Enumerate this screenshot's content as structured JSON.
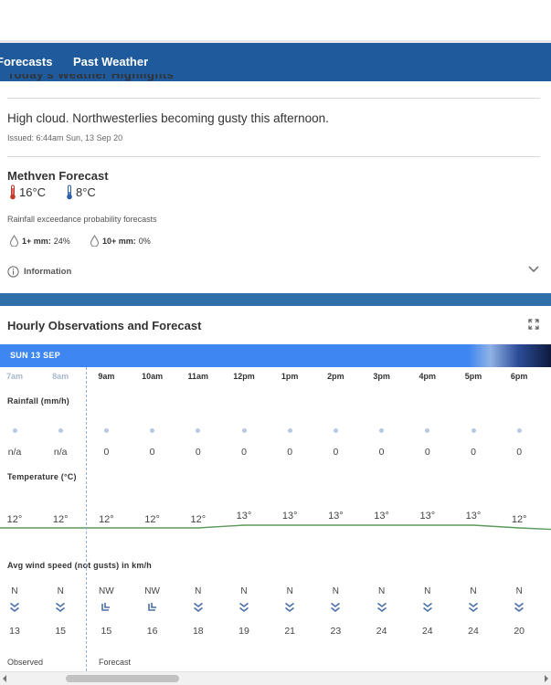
{
  "nav": {
    "items": [
      {
        "label": "Forecasts"
      },
      {
        "label": "Past Weather"
      }
    ]
  },
  "summary": {
    "cut_heading": "Today's Weather Highlights",
    "text": "High cloud. Northwesterlies becoming gusty this afternoon.",
    "issued": "Issued: 6:44am Sun, 13 Sep 20"
  },
  "forecast": {
    "title": "Methven Forecast",
    "high": "16°C",
    "low": "8°C",
    "rainfall_title": "Rainfall exceedance probability forecasts",
    "prob1_label": "1+ mm:",
    "prob1_value": "24%",
    "prob2_label": "10+ mm:",
    "prob2_value": "0%",
    "info_label": "Information"
  },
  "hourly": {
    "title": "Hourly Observations and Forecast",
    "day": "SUN 13 SEP",
    "rainfall_label": "Rainfall (mm/h)",
    "temperature_label": "Temperature (°C)",
    "wind_label": "Avg wind speed (not gusts) in km/h",
    "observed_label": "Observed",
    "forecast_label": "Forecast",
    "hours": [
      "7am",
      "8am",
      "9am",
      "10am",
      "11am",
      "12pm",
      "1pm",
      "2pm",
      "3pm",
      "4pm",
      "5pm",
      "6pm"
    ],
    "observed_count": 2,
    "rainfall": [
      "n/a",
      "n/a",
      "0",
      "0",
      "0",
      "0",
      "0",
      "0",
      "0",
      "0",
      "0",
      "0"
    ],
    "temperature": [
      "12°",
      "12°",
      "12°",
      "12°",
      "12°",
      "13°",
      "13°",
      "13°",
      "13°",
      "13°",
      "13°",
      "12°"
    ],
    "temperature_values": [
      12,
      12,
      12,
      12,
      12,
      13,
      13,
      13,
      13,
      13,
      13,
      12
    ],
    "wind_direction": [
      "N",
      "N",
      "NW",
      "NW",
      "N",
      "N",
      "N",
      "N",
      "N",
      "N",
      "N",
      "N"
    ],
    "wind_speed": [
      "13",
      "15",
      "15",
      "16",
      "18",
      "19",
      "21",
      "23",
      "24",
      "24",
      "24",
      "20"
    ]
  },
  "colors": {
    "nav": "#1e5a9c",
    "day_band": "#3e86f2",
    "temp_line": "#5a9a5a",
    "wind_arrow": "#4a6fa5",
    "therm_hot": "#c0392b",
    "therm_cold": "#2e5da8"
  }
}
